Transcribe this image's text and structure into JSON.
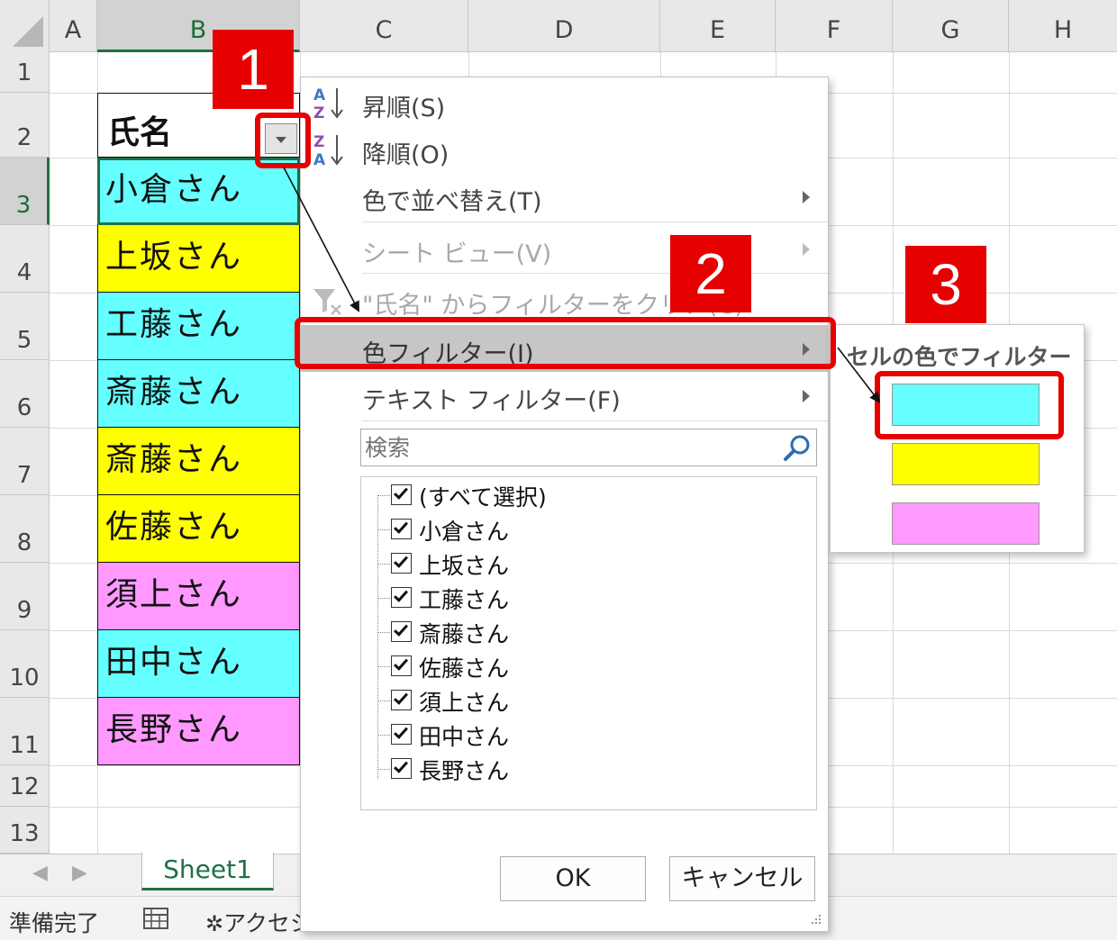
{
  "columns": [
    "A",
    "B",
    "C",
    "D",
    "E",
    "F",
    "G",
    "H"
  ],
  "rows": [
    "1",
    "2",
    "3",
    "4",
    "5",
    "6",
    "7",
    "8",
    "9",
    "10",
    "11",
    "12",
    "13"
  ],
  "table": {
    "header": "氏名",
    "cells": [
      {
        "name": "小倉さん",
        "color": "#66ffff"
      },
      {
        "name": "上坂さん",
        "color": "#ffff00"
      },
      {
        "name": "工藤さん",
        "color": "#66ffff"
      },
      {
        "name": "斎藤さん",
        "color": "#66ffff"
      },
      {
        "name": "斎藤さん",
        "color": "#ffff00"
      },
      {
        "name": "佐藤さん",
        "color": "#ffff00"
      },
      {
        "name": "須上さん",
        "color": "#ff99ff"
      },
      {
        "name": "田中さん",
        "color": "#66ffff"
      },
      {
        "name": "長野さん",
        "color": "#ff99ff"
      }
    ]
  },
  "filter_menu": {
    "sort_asc": "昇順(S)",
    "sort_desc": "降順(O)",
    "sort_by_color": "色で並べ替え(T)",
    "sheet_view": "シート ビュー(V)",
    "clear_filter": "\"氏名\" からフィルターをクリア(C)",
    "color_filter": "色フィルター(I)",
    "text_filter": "テキスト フィルター(F)",
    "search_placeholder": "検索",
    "list": [
      "(すべて選択)",
      "小倉さん",
      "上坂さん",
      "工藤さん",
      "斎藤さん",
      "佐藤さん",
      "須上さん",
      "田中さん",
      "長野さん"
    ],
    "ok": "OK",
    "cancel": "キャンセル"
  },
  "color_submenu": {
    "title": "セルの色でフィルター",
    "colors": [
      "#66ffff",
      "#ffff00",
      "#ff99ff"
    ]
  },
  "sheet_tab": "Sheet1",
  "status": {
    "ready": "準備完了",
    "accessibility": "アクセシ"
  },
  "badges": [
    "1",
    "2",
    "3"
  ],
  "colors": {
    "excel_green": "#1e7145",
    "annotation_red": "#e60000",
    "menu_highlight": "#c6c6c6"
  }
}
